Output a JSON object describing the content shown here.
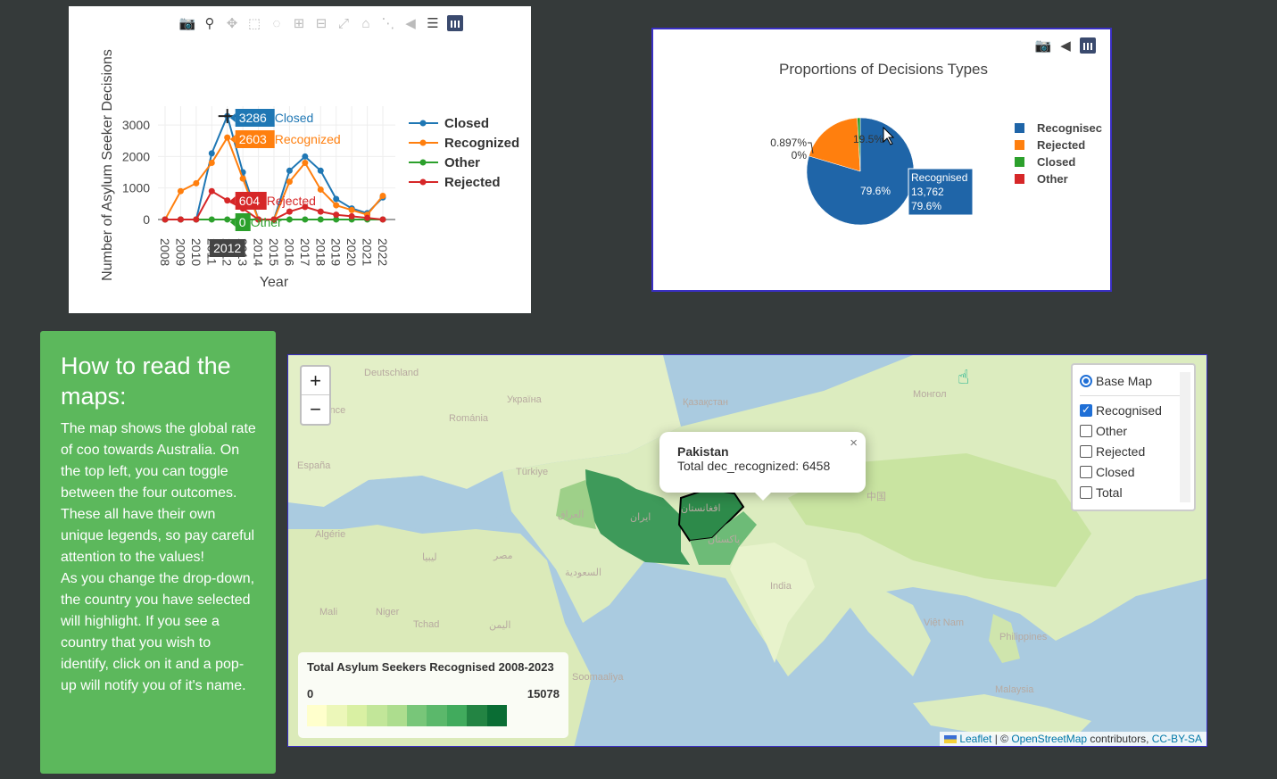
{
  "line_chart": {
    "toolbar_icons": [
      "camera-icon",
      "zoom-icon",
      "pan-icon",
      "box-select-icon",
      "lasso-icon",
      "zoom-in-icon",
      "zoom-out-icon",
      "autoscale-icon",
      "home-icon",
      "spike-icon",
      "hover-closest-icon",
      "hover-compare-icon",
      "plotly-logo-icon"
    ],
    "hover_labels": {
      "closed": "3286",
      "closed_name": "Closed",
      "recognized": "2603",
      "recognized_name": "Recognized",
      "rejected": "604",
      "rejected_name": "Rejected",
      "other": "0",
      "other_name": "Other",
      "x": "2012"
    },
    "colors": {
      "Closed": "#1f77b4",
      "Recognized": "#ff7f0e",
      "Other": "#2ca02c",
      "Rejected": "#d62728"
    }
  },
  "chart_data": [
    {
      "type": "line",
      "title": "",
      "xlabel": "Year",
      "ylabel": "Number of Asylum Seeker Decisions",
      "x": [
        2008,
        2009,
        2010,
        2011,
        2012,
        2013,
        2014,
        2015,
        2016,
        2017,
        2018,
        2019,
        2020,
        2021,
        2022
      ],
      "xticks": [
        "2008",
        "2009",
        "2010",
        "2011",
        "2012",
        "2013",
        "2014",
        "2015",
        "2016",
        "2017",
        "2018",
        "2019",
        "2020",
        "2021",
        "2022"
      ],
      "yticks": [
        "0",
        "1000",
        "2000",
        "3000"
      ],
      "ylim": [
        -200,
        3600
      ],
      "legend_position": "right",
      "legend": [
        "Closed",
        "Recognized",
        "Other",
        "Rejected"
      ],
      "series": [
        {
          "name": "Closed",
          "values": [
            0,
            0,
            0,
            2100,
            3286,
            1500,
            0,
            0,
            1550,
            2000,
            1550,
            650,
            350,
            200,
            700
          ]
        },
        {
          "name": "Recognized",
          "values": [
            0,
            900,
            1150,
            1800,
            2603,
            1300,
            0,
            0,
            1200,
            1800,
            950,
            450,
            300,
            150,
            750
          ]
        },
        {
          "name": "Other",
          "values": [
            0,
            0,
            0,
            0,
            0,
            0,
            0,
            0,
            0,
            0,
            0,
            0,
            0,
            0,
            0
          ]
        },
        {
          "name": "Rejected",
          "values": [
            0,
            0,
            0,
            900,
            604,
            350,
            0,
            0,
            250,
            400,
            250,
            150,
            100,
            50,
            0
          ]
        }
      ]
    },
    {
      "type": "pie",
      "title": "Proportions of Decisions Types",
      "legend": [
        "Recognisec",
        "Rejected",
        "Closed",
        "Other"
      ],
      "legend_position": "right",
      "slices": [
        {
          "label": "Recognised",
          "value": 79.6,
          "color": "#1f65a8",
          "text": "79.6%"
        },
        {
          "label": "Rejected",
          "value": 19.5,
          "color": "#ff7f0e",
          "text": "19.5%"
        },
        {
          "label": "Closed",
          "value": 0.897,
          "color": "#2ca02c",
          "text": "0.897%"
        },
        {
          "label": "Other",
          "value": 0.0,
          "color": "#d62728",
          "text": "0%"
        }
      ],
      "hover": {
        "label": "Recognised",
        "count": "13,762",
        "pct": "79.6%"
      }
    }
  ],
  "info": {
    "title": "How to read the maps:",
    "body_1": "The map shows the global rate of coo towards Australia. On the top left, you can toggle between the four outcomes. These all have their own unique legends, so pay careful attention to the values!",
    "body_2": "As you change the drop-down, the country you have selected will highlight. If you see a country that you wish to identify, click on it and a pop-up will notify you of it's name."
  },
  "map": {
    "zoom_in": "+",
    "zoom_out": "−",
    "layers": {
      "base": "Base Map",
      "overlays": [
        {
          "label": "Recognised",
          "checked": true
        },
        {
          "label": "Other",
          "checked": false
        },
        {
          "label": "Rejected",
          "checked": false
        },
        {
          "label": "Closed",
          "checked": false
        },
        {
          "label": "Total",
          "checked": false
        }
      ]
    },
    "popup": {
      "title": "Pakistan",
      "text": "Total dec_recognized: 6458",
      "close": "×"
    },
    "legend": {
      "title": "Total Asylum Seekers Recognised 2008-2023",
      "min": "0",
      "max": "15078",
      "colors": [
        "#ffffcc",
        "#ecf7b9",
        "#d9f0a3",
        "#c2e699",
        "#addd8e",
        "#78c679",
        "#5bb86b",
        "#41ab5d",
        "#238443",
        "#0a6d34"
      ]
    },
    "attribution": {
      "leaflet": "Leaflet",
      "sep": " | © ",
      "osm": "OpenStreetMap",
      "contrib": " contributors, ",
      "license": "CC-BY-SA"
    },
    "labels": [
      "Deutschland",
      "France",
      "España",
      "Україна",
      "Románia",
      "Türkiye",
      "Қазақстан",
      "Монгол",
      "Algérie",
      "ليبيا",
      "مصر",
      "السعودية",
      "العراق",
      "ایران",
      "پاکستان",
      "افغانستان",
      "中国",
      "India",
      "Mali",
      "Niger",
      "Tchad",
      "اليمن",
      "Soomaaliya",
      "Việt Nam",
      "Philippines",
      "Malaysia"
    ]
  }
}
